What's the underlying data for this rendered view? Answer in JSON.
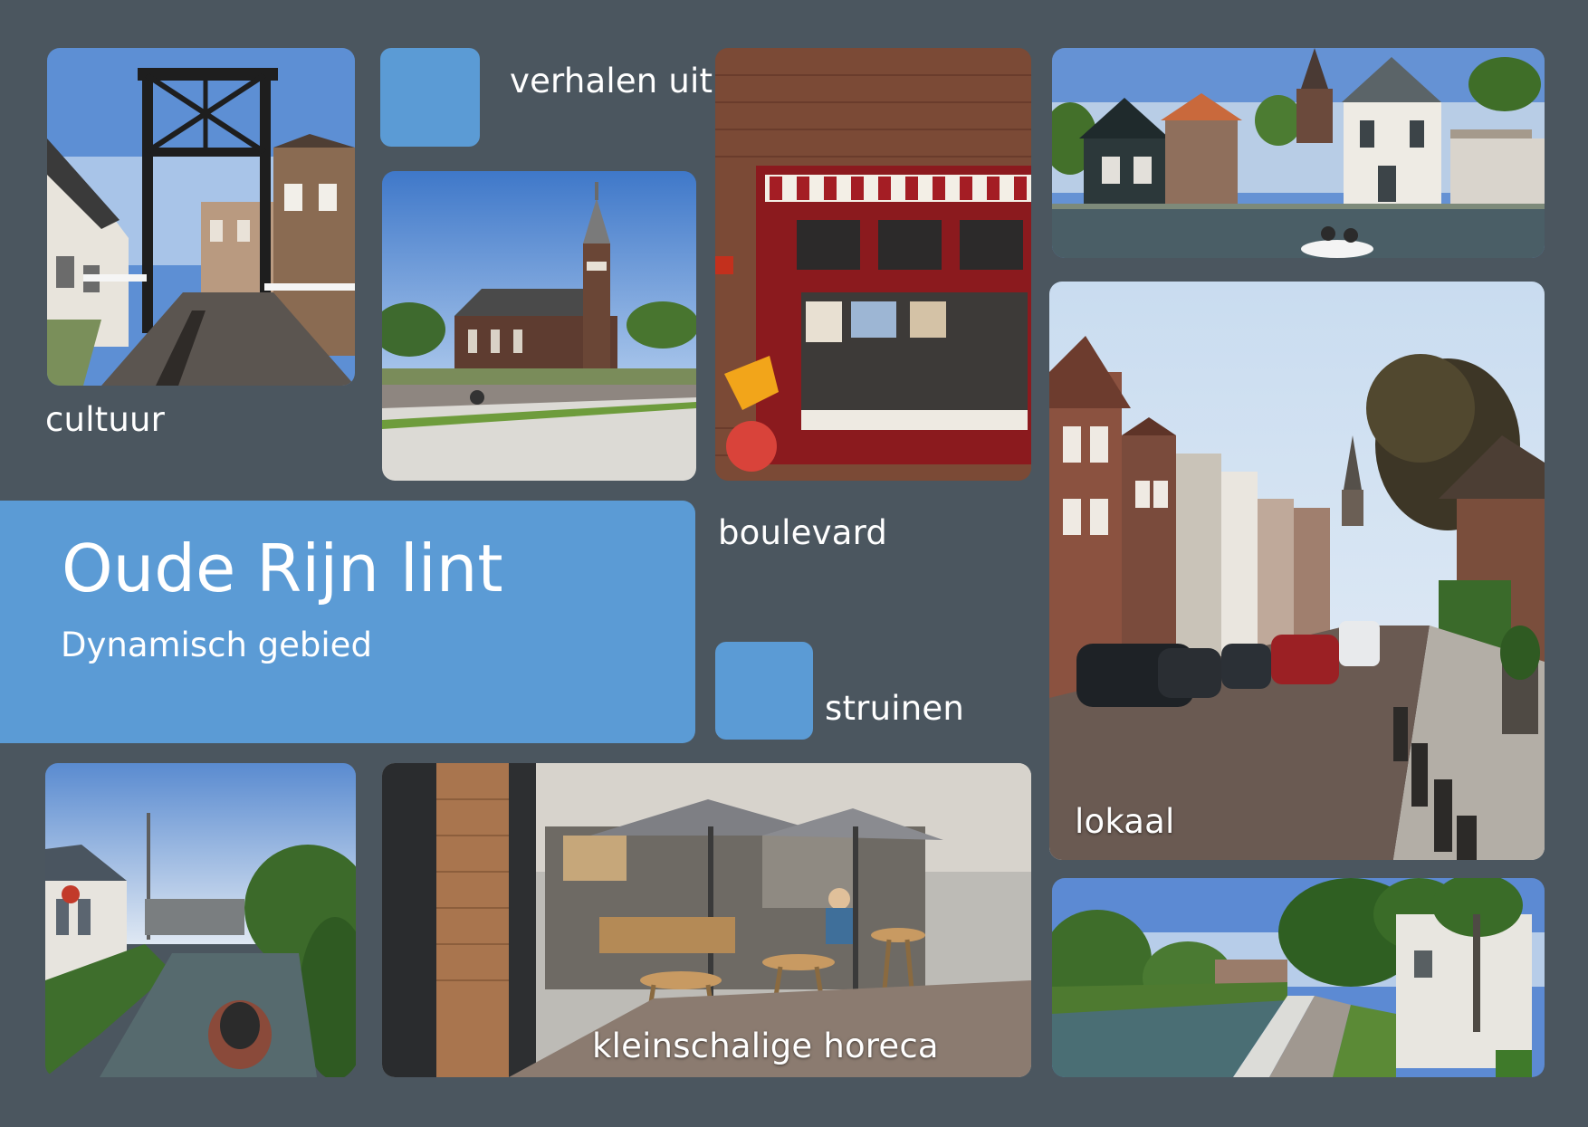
{
  "labels": {
    "cultuur": "cultuur",
    "verhalen": "verhalen uit de buurt",
    "boulevard": "boulevard",
    "struinen": "struinen",
    "lokaal": "lokaal",
    "horeca": "kleinschalige horeca"
  },
  "banner": {
    "title": "Oude Rijn lint",
    "subtitle": "Dynamisch gebied"
  },
  "colors": {
    "background": "#4b565f",
    "accent_blue": "#5b9bd5",
    "text": "#ffffff"
  },
  "photos": [
    {
      "name": "drawbridge-photo",
      "subject": "drawbridge street"
    },
    {
      "name": "church-photo",
      "subject": "church with tower"
    },
    {
      "name": "shop-window-photo",
      "subject": "shop window"
    },
    {
      "name": "canal-houses-photo",
      "subject": "houses along canal with boat"
    },
    {
      "name": "village-street-photo",
      "subject": "village street with parked cars"
    },
    {
      "name": "canal-boat-photo",
      "subject": "canal with small boat"
    },
    {
      "name": "terrace-photo",
      "subject": "cafe terrace with umbrellas"
    },
    {
      "name": "river-path-photo",
      "subject": "river with path and trees"
    }
  ]
}
